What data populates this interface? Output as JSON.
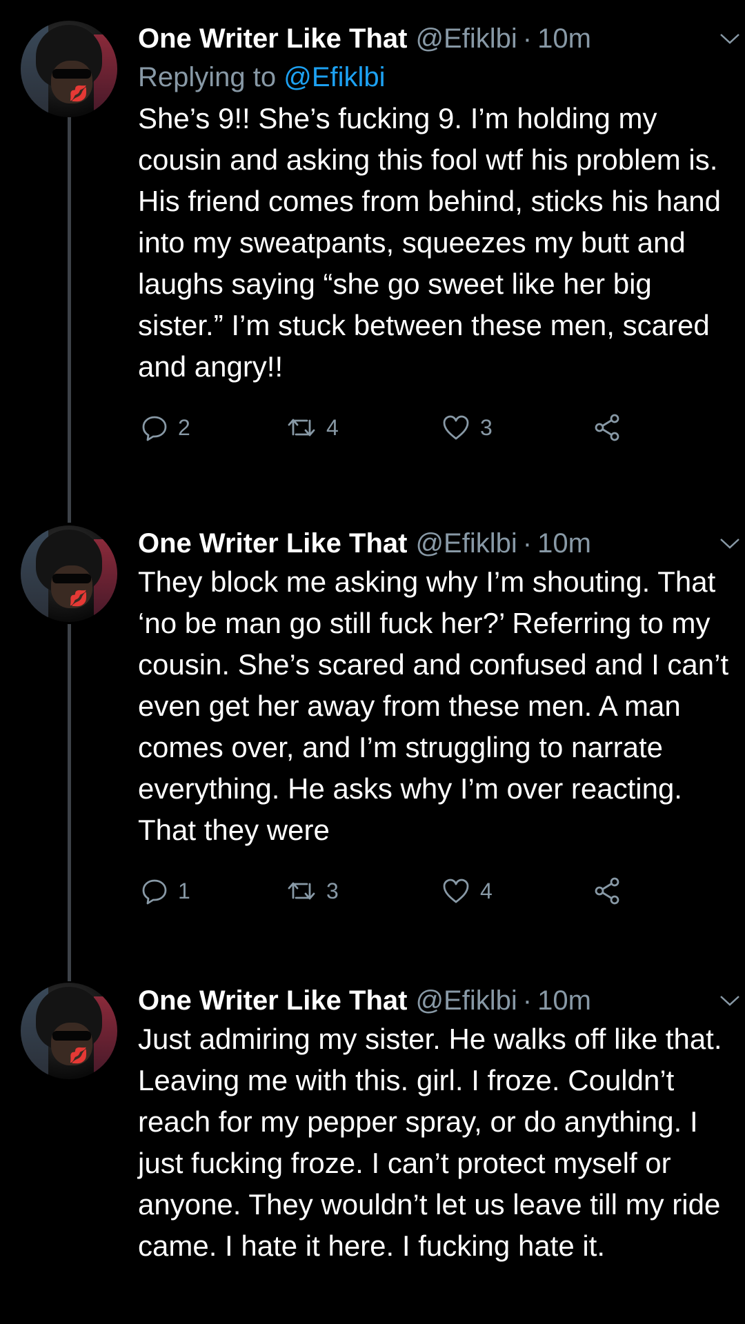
{
  "tweets": [
    {
      "name": "One Writer Like That",
      "handle": "@Efiklbi",
      "dot": "·",
      "time": "10m",
      "reply_prefix": "Replying to",
      "reply_mention": "@Efiklbi",
      "text": "She’s 9!! She’s fucking 9. I’m holding my cousin and asking this fool wtf his problem is. His friend comes from behind, sticks his hand into my sweatpants, squeezes my butt and laughs saying “she go sweet like her big sister.” I’m stuck between these men, scared and angry!!",
      "replies": "2",
      "retweets": "4",
      "likes": "3"
    },
    {
      "name": "One Writer Like That",
      "handle": "@Efiklbi",
      "dot": "·",
      "time": "10m",
      "text": "They block me asking why I’m shouting. That ‘no be man go still fuck her?’ Referring to my cousin. She’s scared and confused and I can’t even get her away from these men. A man comes over, and I’m struggling to narrate everything. He asks why I’m over reacting. That they were",
      "replies": "1",
      "retweets": "3",
      "likes": "4"
    },
    {
      "name": "One Writer Like That",
      "handle": "@Efiklbi",
      "dot": "·",
      "time": "10m",
      "text": "Just admiring my sister. He walks off like that. Leaving me with this. girl. I froze. Couldn’t reach for my pepper spray, or do anything. I just fucking froze. I can’t protect myself or anyone. They wouldn’t let us leave till my ride came. I hate it here. I fucking hate it."
    }
  ],
  "icons": {
    "reply": "reply-icon",
    "retweet": "retweet-icon",
    "like": "heart-icon",
    "share": "share-icon",
    "menu": "chevron-down-icon"
  },
  "colors": {
    "background": "#000000",
    "text": "#ffffff",
    "secondary": "#8899a6",
    "mention": "#1da1f2",
    "thread_line": "#3d4248"
  }
}
